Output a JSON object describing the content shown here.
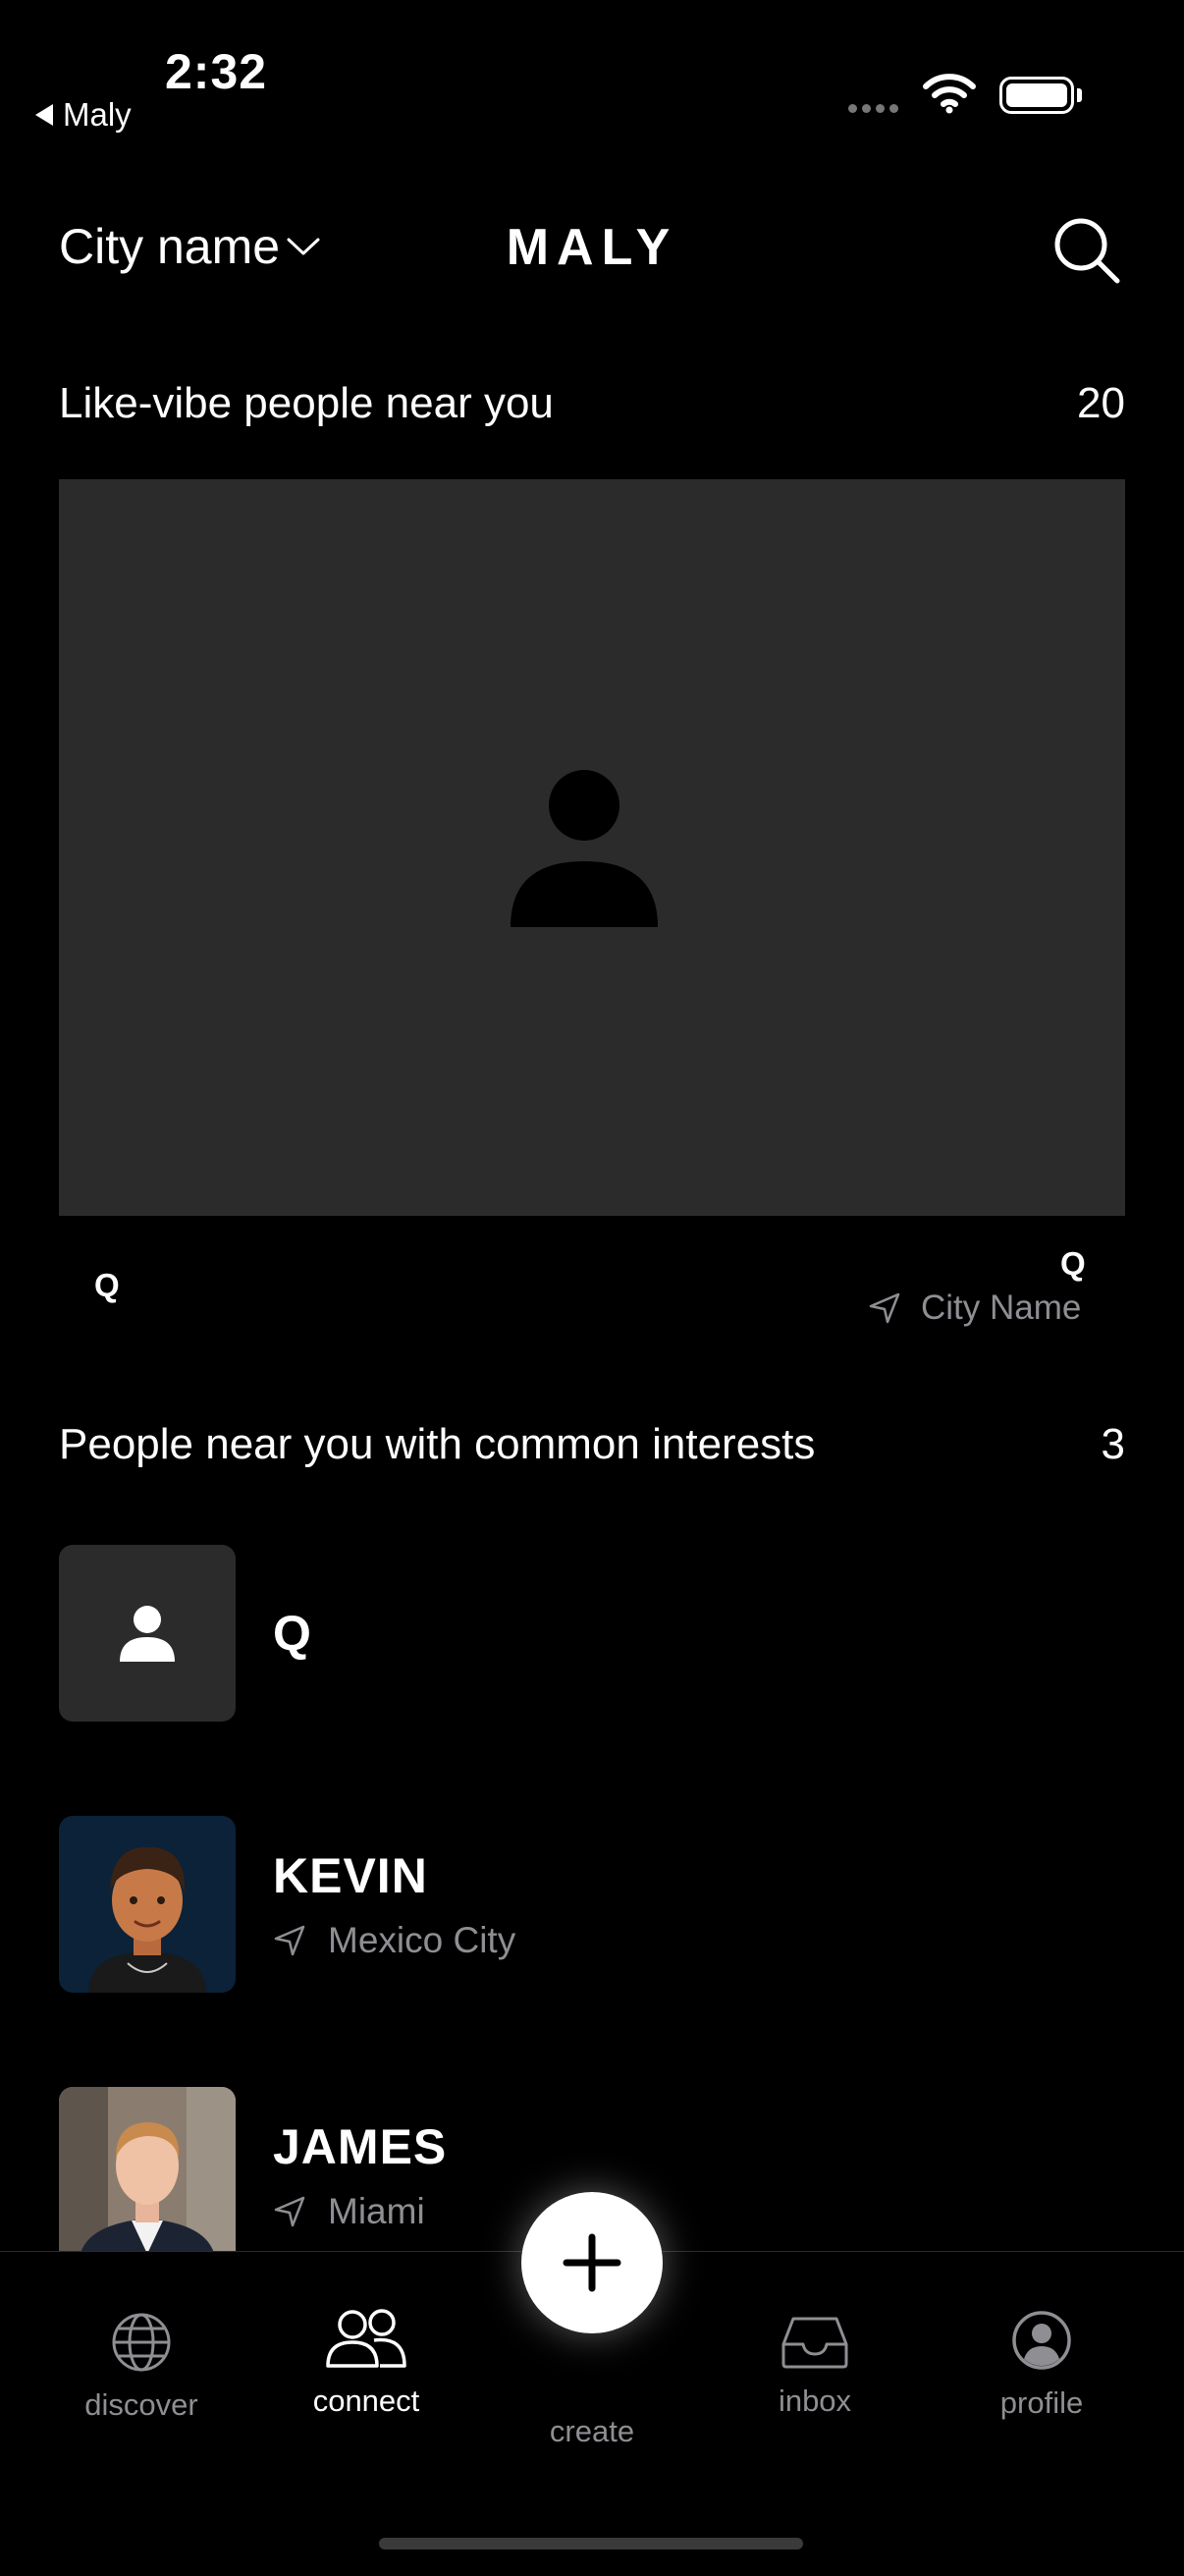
{
  "status_bar": {
    "time": "2:32",
    "back_app": "Maly"
  },
  "header": {
    "city_select": "City name",
    "logo": "MALY"
  },
  "like_vibe": {
    "title": "Like-vibe people near you",
    "count": "20",
    "card": {
      "left_initial": "Q",
      "right_initial": "Q",
      "location": "City Name"
    }
  },
  "common_interests": {
    "title": "People near you with common interests",
    "count": "3",
    "people": [
      {
        "name": "Q",
        "location": ""
      },
      {
        "name": "KEVIN",
        "location": "Mexico City"
      },
      {
        "name": "JAMES",
        "location": "Miami"
      }
    ]
  },
  "tabbar": {
    "discover": "discover",
    "connect": "connect",
    "create": "create",
    "inbox": "inbox",
    "profile": "profile",
    "active": "connect"
  },
  "colors": {
    "background": "#000000",
    "card": "#2b2b2b",
    "muted_text": "#8e8e93",
    "accent": "#ffffff"
  }
}
